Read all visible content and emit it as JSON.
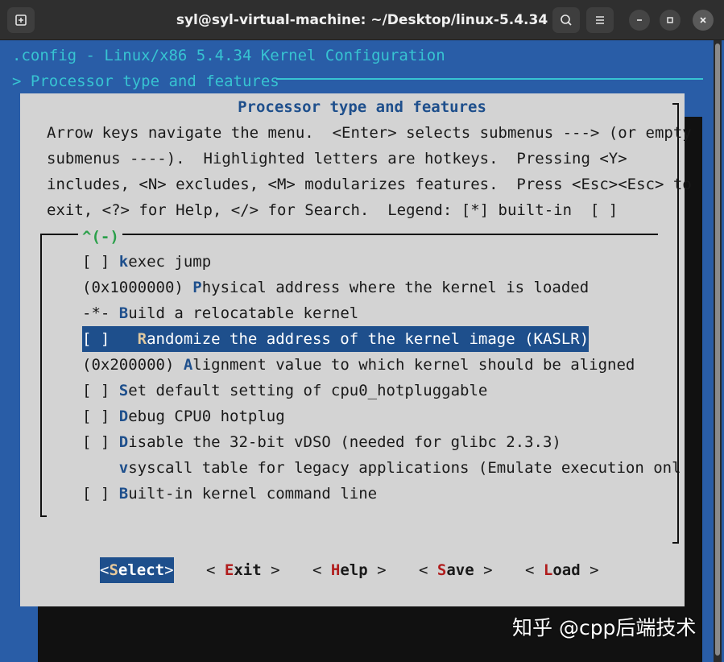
{
  "window": {
    "title": "syl@syl-virtual-machine: ~/Desktop/linux-5.4.34"
  },
  "terminal": {
    "config_line": ".config - Linux/x86 5.4.34 Kernel Configuration",
    "section_line": "> Processor type and features"
  },
  "dialog": {
    "title": "Processor type and features",
    "help_lines": [
      "Arrow keys navigate the menu.  <Enter> selects submenus ---> (or empty",
      "submenus ----).  Highlighted letters are hotkeys.  Pressing <Y>",
      "includes, <N> excludes, <M> modularizes features.  Press <Esc><Esc> to",
      "exit, <?> for Help, </> for Search.  Legend: [*] built-in  [ ]"
    ],
    "scroll_indicator": "^(-)",
    "menu_items": [
      {
        "prefix": "[ ] ",
        "hotkey": "k",
        "rest": "exec jump"
      },
      {
        "prefix": "(0x1000000) ",
        "hotkey": "P",
        "rest": "hysical address where the kernel is loaded"
      },
      {
        "prefix": "-*- ",
        "hotkey": "B",
        "rest": "uild a relocatable kernel"
      },
      {
        "prefix": "[ ]   ",
        "hotkey": "R",
        "rest": "andomize the address of the kernel image (KASLR)"
      },
      {
        "prefix": "(0x200000) ",
        "hotkey": "A",
        "rest": "lignment value to which kernel should be aligned"
      },
      {
        "prefix": "[ ] ",
        "hotkey": "S",
        "rest": "et default setting of cpu0_hotpluggable"
      },
      {
        "prefix": "[ ] ",
        "hotkey": "D",
        "rest": "ebug CPU0 hotplug"
      },
      {
        "prefix": "[ ] ",
        "hotkey": "D",
        "rest": "isable the 32-bit vDSO (needed for glibc 2.3.3)"
      },
      {
        "prefix": "    ",
        "hotkey": "v",
        "rest": "syscall table for legacy applications (Emulate execution onl"
      },
      {
        "prefix": "[ ] ",
        "hotkey": "B",
        "rest": "uilt-in kernel command line"
      }
    ],
    "selected_index": 3,
    "buttons": [
      {
        "open": "<",
        "hotkey": "S",
        "rest": "elect",
        "close": ">"
      },
      {
        "open": "< ",
        "hotkey": "E",
        "rest": "xit",
        "close": " >"
      },
      {
        "open": "< ",
        "hotkey": "H",
        "rest": "elp",
        "close": " >"
      },
      {
        "open": "< ",
        "hotkey": "S",
        "rest": "ave",
        "close": " >"
      },
      {
        "open": "< ",
        "hotkey": "L",
        "rest": "oad",
        "close": " >"
      }
    ]
  },
  "watermark": "知乎 @cpp后端技术"
}
